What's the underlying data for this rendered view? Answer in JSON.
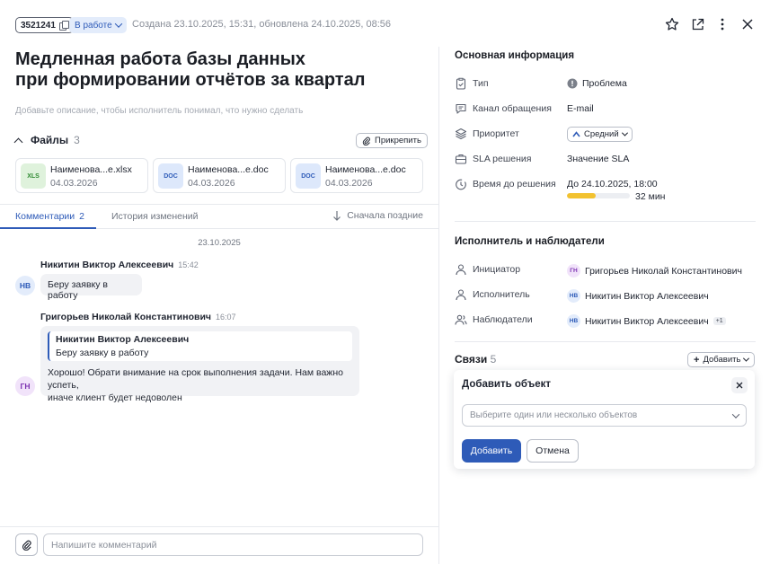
{
  "header": {
    "ticket_id": "3521241",
    "status": "В работе",
    "meta": "Создана 23.10.2025, 15:31, обновлена 24.10.2025, 08:56"
  },
  "ticket": {
    "title_line1": "Медленная работа базы данных",
    "title_line2": "при формировании отчётов за квартал",
    "description_placeholder": "Добавьте описание, чтобы исполнитель понимал, что нужно сделать"
  },
  "files": {
    "label": "Файлы",
    "count": "3",
    "attach_label": "Прикрепить",
    "items": [
      {
        "icon": "XLS",
        "name": "Наименова...e.xlsx",
        "date": "04.03.2026"
      },
      {
        "icon": "DOC",
        "name": "Наименова...e.doc",
        "date": "04.03.2026"
      },
      {
        "icon": "DOC",
        "name": "Наименова...e.doc",
        "date": "04.03.2026"
      }
    ]
  },
  "tabs": {
    "comments_label": "Комментарии",
    "comments_count": "2",
    "history_label": "История изменений",
    "sort_label": "Сначала поздние"
  },
  "comments": {
    "date": "23.10.2025",
    "items": [
      {
        "author": "Никитин Виктор Алексеевич",
        "time": "15:42",
        "initials": "НВ",
        "text": "Беру заявку в работу"
      },
      {
        "author": "Григорьев Николай Константинович",
        "time": "16:07",
        "initials": "ГН",
        "quote_author": "Никитин Виктор Алексеевич",
        "quote_text": "Беру заявку в работу",
        "text_line1": "Хорошо! Обрати внимание на срок выполнения задачи. Нам важно успеть,",
        "text_line2": "иначе клиент будет недоволен"
      }
    ]
  },
  "composer": {
    "placeholder": "Напишите комментарий"
  },
  "main_info": {
    "title": "Основная информация",
    "type_label": "Тип",
    "type_value": "Проблема",
    "channel_label": "Канал обращения",
    "channel_value": "E-mail",
    "priority_label": "Приоритет",
    "priority_value": "Средний",
    "sla_label": "SLA решения",
    "sla_value": "Значение SLA",
    "deadline_label": "Время до решения",
    "deadline_value": "До 24.10.2025, 18:00",
    "remaining": "32 мин",
    "remaining_fraction": 0.45
  },
  "people": {
    "title": "Исполнитель и наблюдатели",
    "initiator_label": "Инициатор",
    "initiator_initials": "ГН",
    "initiator_name": "Григорьев Николай Константинович",
    "assignee_label": "Исполнитель",
    "assignee_initials": "НВ",
    "assignee_name": "Никитин Виктор Алексеевич",
    "watchers_label": "Наблюдатели",
    "watchers_initials": "НВ",
    "watchers_name": "Никитин Виктор Алексеевич",
    "watchers_more": "+1"
  },
  "links": {
    "title": "Связи",
    "count": "5",
    "add_label": "Добавить"
  },
  "popover": {
    "title": "Добавить объект",
    "select_placeholder": "Выберите один или несколько объектов",
    "add_button": "Добавить",
    "cancel_button": "Отмена"
  },
  "colors": {
    "accent": "#2e5bb8",
    "progress": "#f2c230"
  }
}
